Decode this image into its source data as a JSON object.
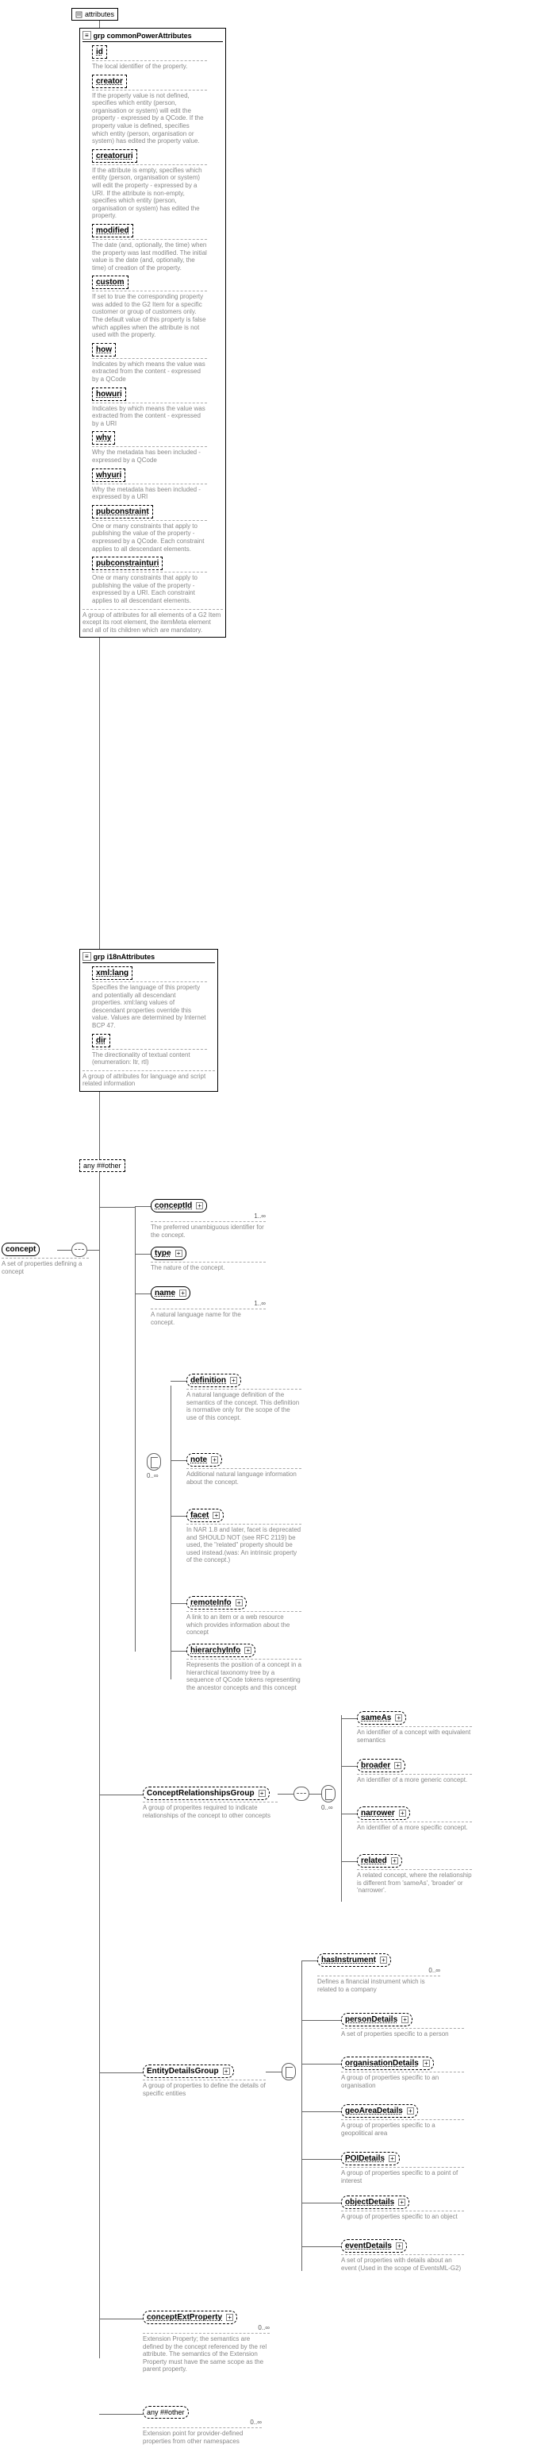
{
  "root": {
    "name": "concept",
    "ann": "A set of properties defining a concept"
  },
  "attrs_header": "attributes",
  "grp1": {
    "title": "grp commonPowerAttributes",
    "items": [
      {
        "n": "id",
        "a": "The local identifier of the property."
      },
      {
        "n": "creator",
        "a": "If the property value is not defined, specifies which entity (person, organisation or system) will edit the property - expressed by a QCode. If the property value is defined, specifies which entity (person, organisation or system) has edited the property value."
      },
      {
        "n": "creatoruri",
        "a": "If the attribute is empty, specifies which entity (person, organisation or system) will edit the property - expressed by a URI. If the attribute is non-empty, specifies which entity (person, organisation or system) has edited the property."
      },
      {
        "n": "modified",
        "a": "The date (and, optionally, the time) when the property was last modified. The initial value is the date (and, optionally, the time) of creation of the property."
      },
      {
        "n": "custom",
        "a": "If set to true the corresponding property was added to the G2 Item for a specific customer or group of customers only. The default value of this property is false which applies when the attribute is not used with the property."
      },
      {
        "n": "how",
        "a": "Indicates by which means the value was extracted from the content - expressed by a QCode"
      },
      {
        "n": "howuri",
        "a": "Indicates by which means the value was extracted from the content - expressed by a URI"
      },
      {
        "n": "why",
        "a": "Why the metadata has been included - expressed by a QCode"
      },
      {
        "n": "whyuri",
        "a": "Why the metadata has been included - expressed by a URI"
      },
      {
        "n": "pubconstraint",
        "a": "One or many constraints that apply to publishing the value of the property - expressed by a QCode. Each constraint applies to all descendant elements."
      },
      {
        "n": "pubconstrainturi",
        "a": "One or many constraints that apply to publishing the value of the property - expressed by a URI. Each constraint applies to all descendant elements."
      }
    ],
    "footer": "A group of attributes for all elements of a G2 Item except its root element, the itemMeta element and all of its children which are mandatory."
  },
  "grp2": {
    "title": "grp i18nAttributes",
    "items": [
      {
        "n": "xml:lang",
        "a": "Specifies the language of this property and potentially all descendant properties. xml:lang values of descendant properties override this value. Values are determined by Internet BCP 47."
      },
      {
        "n": "dir",
        "a": "The directionality of textual content (enumeration: ltr, rtl)"
      }
    ],
    "footer": "A group of attributes for language and script related information"
  },
  "any_other": "any ##other",
  "children": [
    {
      "n": "conceptId",
      "c": "1..∞",
      "a": "The preferred unambiguous identifier for the concept."
    },
    {
      "n": "type",
      "c": "",
      "a": "The nature of the concept."
    },
    {
      "n": "name",
      "c": "1..∞",
      "a": "A natural language name for the concept."
    },
    {
      "n": "definition",
      "c": "",
      "a": "A natural language definition of the semantics of the concept. This definition is normative only for the scope of the use of this concept."
    },
    {
      "n": "note",
      "c": "",
      "a": "Additional natural language information about the concept."
    },
    {
      "n": "facet",
      "c": "",
      "a": "In NAR 1.8 and later, facet is deprecated and SHOULD NOT (see RFC 2119) be used, the \"related\" property should be used instead.(was: An intrinsic property of the concept.)"
    },
    {
      "n": "remoteInfo",
      "c": "",
      "a": "A link to an item or a web resource which provides information about the concept"
    },
    {
      "n": "hierarchyInfo",
      "c": "",
      "a": "Represents the position of a concept in a hierarchical taxonomy tree by a sequence of QCode tokens representing the ancestor concepts and this concept"
    }
  ],
  "choice_card": "0..∞",
  "crg": {
    "n": "ConceptRelationshipsGroup",
    "a": "A group of properites required to indicate relationships of the concept to other concepts",
    "c": "0..∞",
    "items": [
      {
        "n": "sameAs",
        "a": "An identifier of a concept with equivalent semantics"
      },
      {
        "n": "broader",
        "a": "An identifier of a more generic concept."
      },
      {
        "n": "narrower",
        "a": "An identifier of a more specific concept."
      },
      {
        "n": "related",
        "a": "A related concept, where the relationship is different from 'sameAs', 'broader' or 'narrower'."
      }
    ]
  },
  "edg": {
    "n": "EntityDetailsGroup",
    "a": "A group of properties to define the details of specific entities",
    "items": [
      {
        "n": "hasInstrument",
        "c": "0..∞",
        "a": "Defines a financial instrument which is related to a company"
      },
      {
        "n": "personDetails",
        "a": "A set of properties specific to a person"
      },
      {
        "n": "organisationDetails",
        "a": "A group of properties specific to an organisation"
      },
      {
        "n": "geoAreaDetails",
        "a": "A group of properties specific to a geopolitical area"
      },
      {
        "n": "POIDetails",
        "a": "A group of properties specific to a point of interest"
      },
      {
        "n": "objectDetails",
        "a": "A group of properties specific to an object"
      },
      {
        "n": "eventDetails",
        "a": "A set of properties with details about an event (Used in the scope of EventsML-G2)"
      }
    ]
  },
  "cep": {
    "n": "conceptExtProperty",
    "c": "0..∞",
    "a": "Extension Property; the semantics are defined by the concept referenced by the rel attribute. The semantics of the Extension Property must have the same scope as the parent property."
  },
  "anyo": {
    "n": "any ##other",
    "c": "0..∞",
    "a": "Extension point for provider-defined properties from other namespaces"
  }
}
